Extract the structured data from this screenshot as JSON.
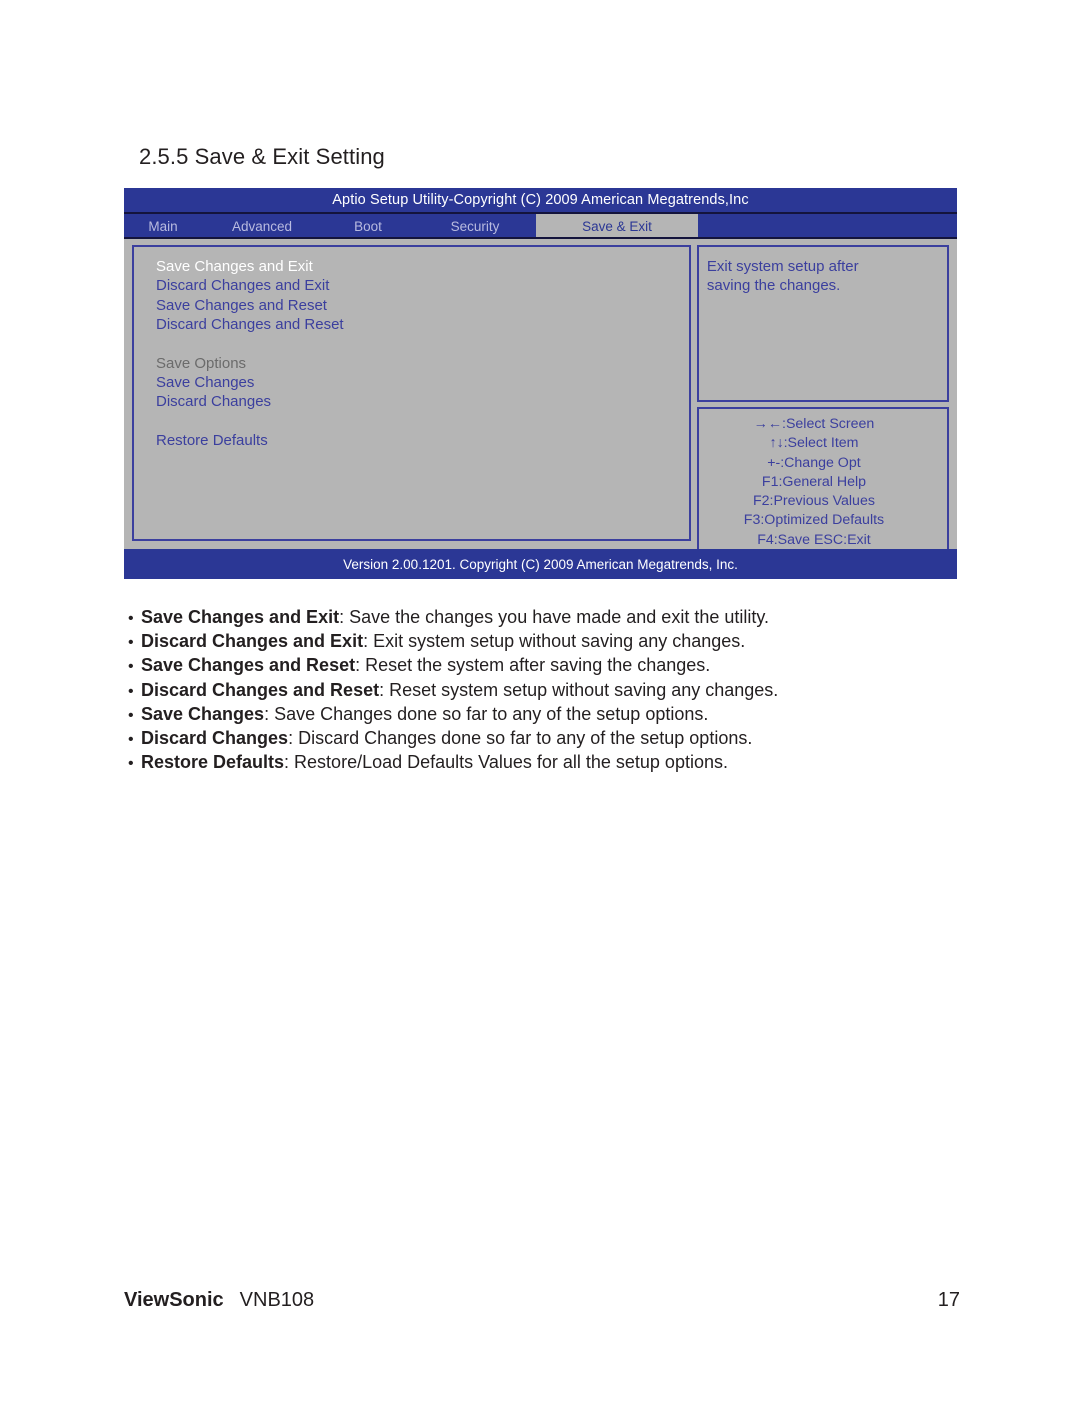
{
  "document": {
    "section_heading": "2.5.5 Save & Exit Setting"
  },
  "bios": {
    "title": "Aptio Setup Utility-Copyright (C) 2009 American Megatrends,Inc",
    "version_bar": "Version 2.00.1201. Copyright (C)  2009 American Megatrends, Inc.",
    "menu_tabs": [
      {
        "label": "Main",
        "active": false
      },
      {
        "label": "Advanced",
        "active": false
      },
      {
        "label": "Boot",
        "active": false
      },
      {
        "label": "Security",
        "active": false
      },
      {
        "label": "Save & Exit",
        "active": true
      }
    ],
    "items": [
      {
        "label": "Save Changes and Exit",
        "style": "selected"
      },
      {
        "label": "Discard Changes and Exit",
        "style": "normal"
      },
      {
        "label": "Save Changes and Reset",
        "style": "normal"
      },
      {
        "label": "Discard Changes and Reset",
        "style": "normal"
      },
      {
        "label": "",
        "style": "spacer"
      },
      {
        "label": "Save Options",
        "style": "header"
      },
      {
        "label": "Save Changes",
        "style": "normal"
      },
      {
        "label": "Discard Changes",
        "style": "normal"
      },
      {
        "label": "",
        "style": "spacer"
      },
      {
        "label": "Restore Defaults",
        "style": "normal"
      }
    ],
    "help": {
      "line1": "Exit system setup after",
      "line2": "saving the changes."
    },
    "legend": [
      "→←:Select Screen",
      "↑↓:Select Item",
      "+-:Change Opt",
      "F1:General Help",
      "F2:Previous Values",
      "F3:Optimized Defaults",
      "F4:Save   ESC:Exit"
    ],
    "colors": {
      "window_bg": "#b5b5b5",
      "bar_blue": "#2b3795",
      "text_blue": "#3b3f9e",
      "selected_text": "#ffffff",
      "header_text": "#6b6b6b",
      "bar_divider": "#14143c",
      "inactive_tab_text": "#b9bbe0"
    }
  },
  "descriptions": {
    "bullet_char": "•",
    "items": [
      {
        "term": "Save Changes and Exit",
        "rest": " : Save the changes you have made and exit the utility."
      },
      {
        "term": "Discard Changes and Exit",
        "rest": " : Exit system setup without saving any changes."
      },
      {
        "term": "Save Changes and Reset",
        "rest": ": Reset the system after saving the changes."
      },
      {
        "term": "Discard Changes and Reset",
        "rest": ": Reset system setup without saving any changes."
      },
      {
        "term": "Save Changes",
        "rest": " : Save Changes done so far to any of the setup options."
      },
      {
        "term": "Discard Changes",
        "rest": " : Discard Changes done so far to any of the setup options."
      },
      {
        "term": "Restore Defaults",
        "rest": " : Restore/Load Defaults Values for all the setup options."
      }
    ]
  },
  "footer": {
    "brand": "ViewSonic",
    "model": "VNB108",
    "page_number": "17"
  }
}
